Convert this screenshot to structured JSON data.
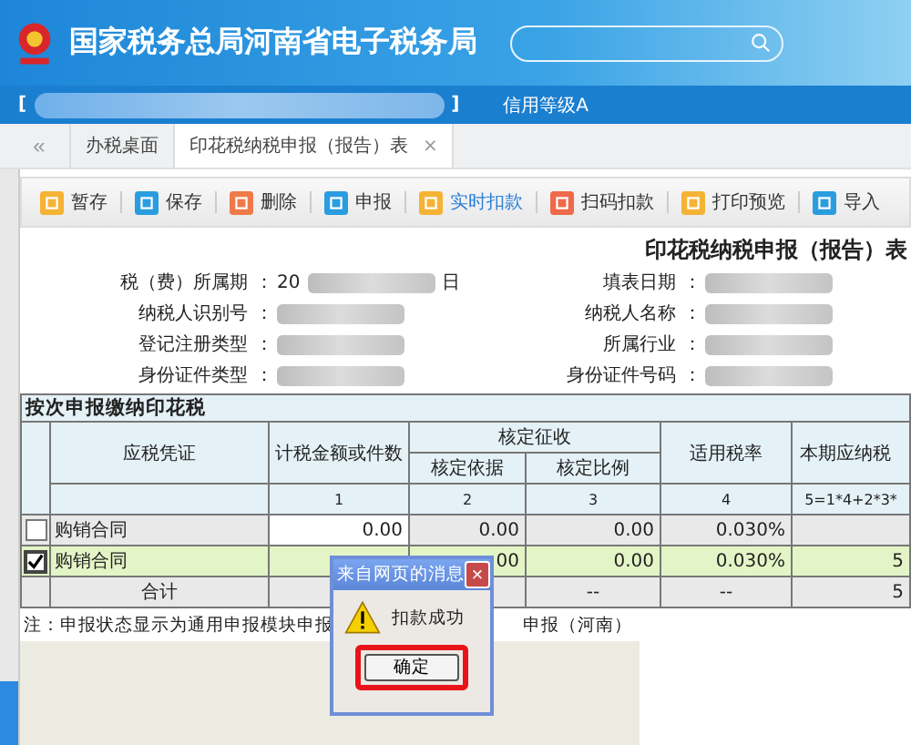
{
  "header": {
    "title": "国家税务总局河南省电子税务局"
  },
  "user_bar": {
    "open_bracket": "[",
    "close_bracket": "]",
    "credit": "信用等级A"
  },
  "tabs": [
    {
      "label": "«",
      "kind": "nav",
      "selected": false
    },
    {
      "label": "办税桌面",
      "kind": "tab",
      "selected": false
    },
    {
      "label": "印花税纳税申报（报告）表",
      "kind": "tab",
      "selected": true,
      "close": "×"
    }
  ],
  "toolbar": [
    {
      "label": "暂存",
      "kind": "draft",
      "active": false
    },
    {
      "label": "保存",
      "kind": "save",
      "active": false
    },
    {
      "label": "删除",
      "kind": "delete",
      "active": false
    },
    {
      "label": "申报",
      "kind": "submit",
      "active": false
    },
    {
      "label": "实时扣款",
      "kind": "pay",
      "active": true
    },
    {
      "label": "扫码扣款",
      "kind": "scan",
      "active": false
    },
    {
      "label": "打印预览",
      "kind": "print",
      "active": false
    },
    {
      "label": "导入",
      "kind": "import",
      "active": false
    }
  ],
  "form": {
    "title": "印花税纳税申报（报告）表",
    "left_fields": [
      {
        "label": "税（费）所属期",
        "colon": "：",
        "value_start": "20",
        "value_end": "日"
      },
      {
        "label": "纳税人识别号",
        "colon": "："
      },
      {
        "label": "登记注册类型",
        "colon": "："
      },
      {
        "label": "身份证件类型",
        "colon": "："
      }
    ],
    "right_fields": [
      {
        "label": "填表日期",
        "colon": "："
      },
      {
        "label": "纳税人名称",
        "colon": "："
      },
      {
        "label": "所属行业",
        "colon": "："
      },
      {
        "label": "身份证件号码",
        "colon": "："
      }
    ]
  },
  "section": "按次申报缴纳印花税",
  "table": {
    "voucher": "应税凭证",
    "amount": "计税金额或件数",
    "assessed": "核定征收",
    "basis": "核定依据",
    "ratio": "核定比例",
    "rate": "适用税率",
    "due": "本期应纳税",
    "numbers": {
      "amount": "1",
      "basis": "2",
      "ratio": "3",
      "rate": "4",
      "due": "5=1*4+2*3*"
    },
    "rows": [
      {
        "checked": false,
        "selected": false,
        "voucher": "购销合同",
        "amount": "0.00",
        "basis": "0.00",
        "ratio": "0.00",
        "rate": "0.030%"
      },
      {
        "checked": true,
        "selected": true,
        "voucher": "购销合同",
        "basis": "00",
        "ratio": "0.00",
        "rate": "0.030%",
        "due": "5"
      }
    ],
    "total": {
      "voucher": "合计",
      "ratio": "--",
      "rate": "--",
      "due": "5"
    }
  },
  "note": {
    "start": "注：申报状态显示为通用申报模块申报",
    "end": "申报（河南）"
  },
  "dialog": {
    "title": "来自网页的消息",
    "close": "×",
    "message": "扣款成功",
    "button": "确定",
    "highlighted": true
  }
}
